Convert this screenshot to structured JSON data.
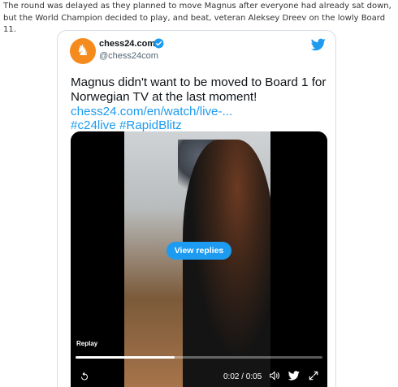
{
  "article": {
    "paragraph": "The round was delayed as they planned to move Magnus after everyone had already sat down, but the World Champion decided to play, and beat, veteran Aleksey Dreev on the lowly Board 11."
  },
  "tweet": {
    "account_name": "chess24.com",
    "account_handle": "@chess24com",
    "verified": true,
    "text": "Magnus didn't want to be moved to Board 1 for Norwegian TV at the last moment!",
    "link": "chess24.com/en/watch/live-...",
    "hashtags": "#c24live #RapidBlitz",
    "icons": {
      "avatar": "chess-knight-icon",
      "verified": "verified-badge-icon",
      "brand": "twitter-bird-icon"
    }
  },
  "video": {
    "overlay_button": "View replies",
    "replay_label": "Replay",
    "time": "0:02 / 0:05",
    "progress": 0.4,
    "icons": [
      "replay-icon",
      "volume-icon",
      "twitter-bird-icon",
      "fullscreen-icon"
    ]
  },
  "colors": {
    "accent": "#1d9bf0",
    "avatar": "#f58b1c",
    "text": "#0f1419",
    "muted": "#536471"
  }
}
